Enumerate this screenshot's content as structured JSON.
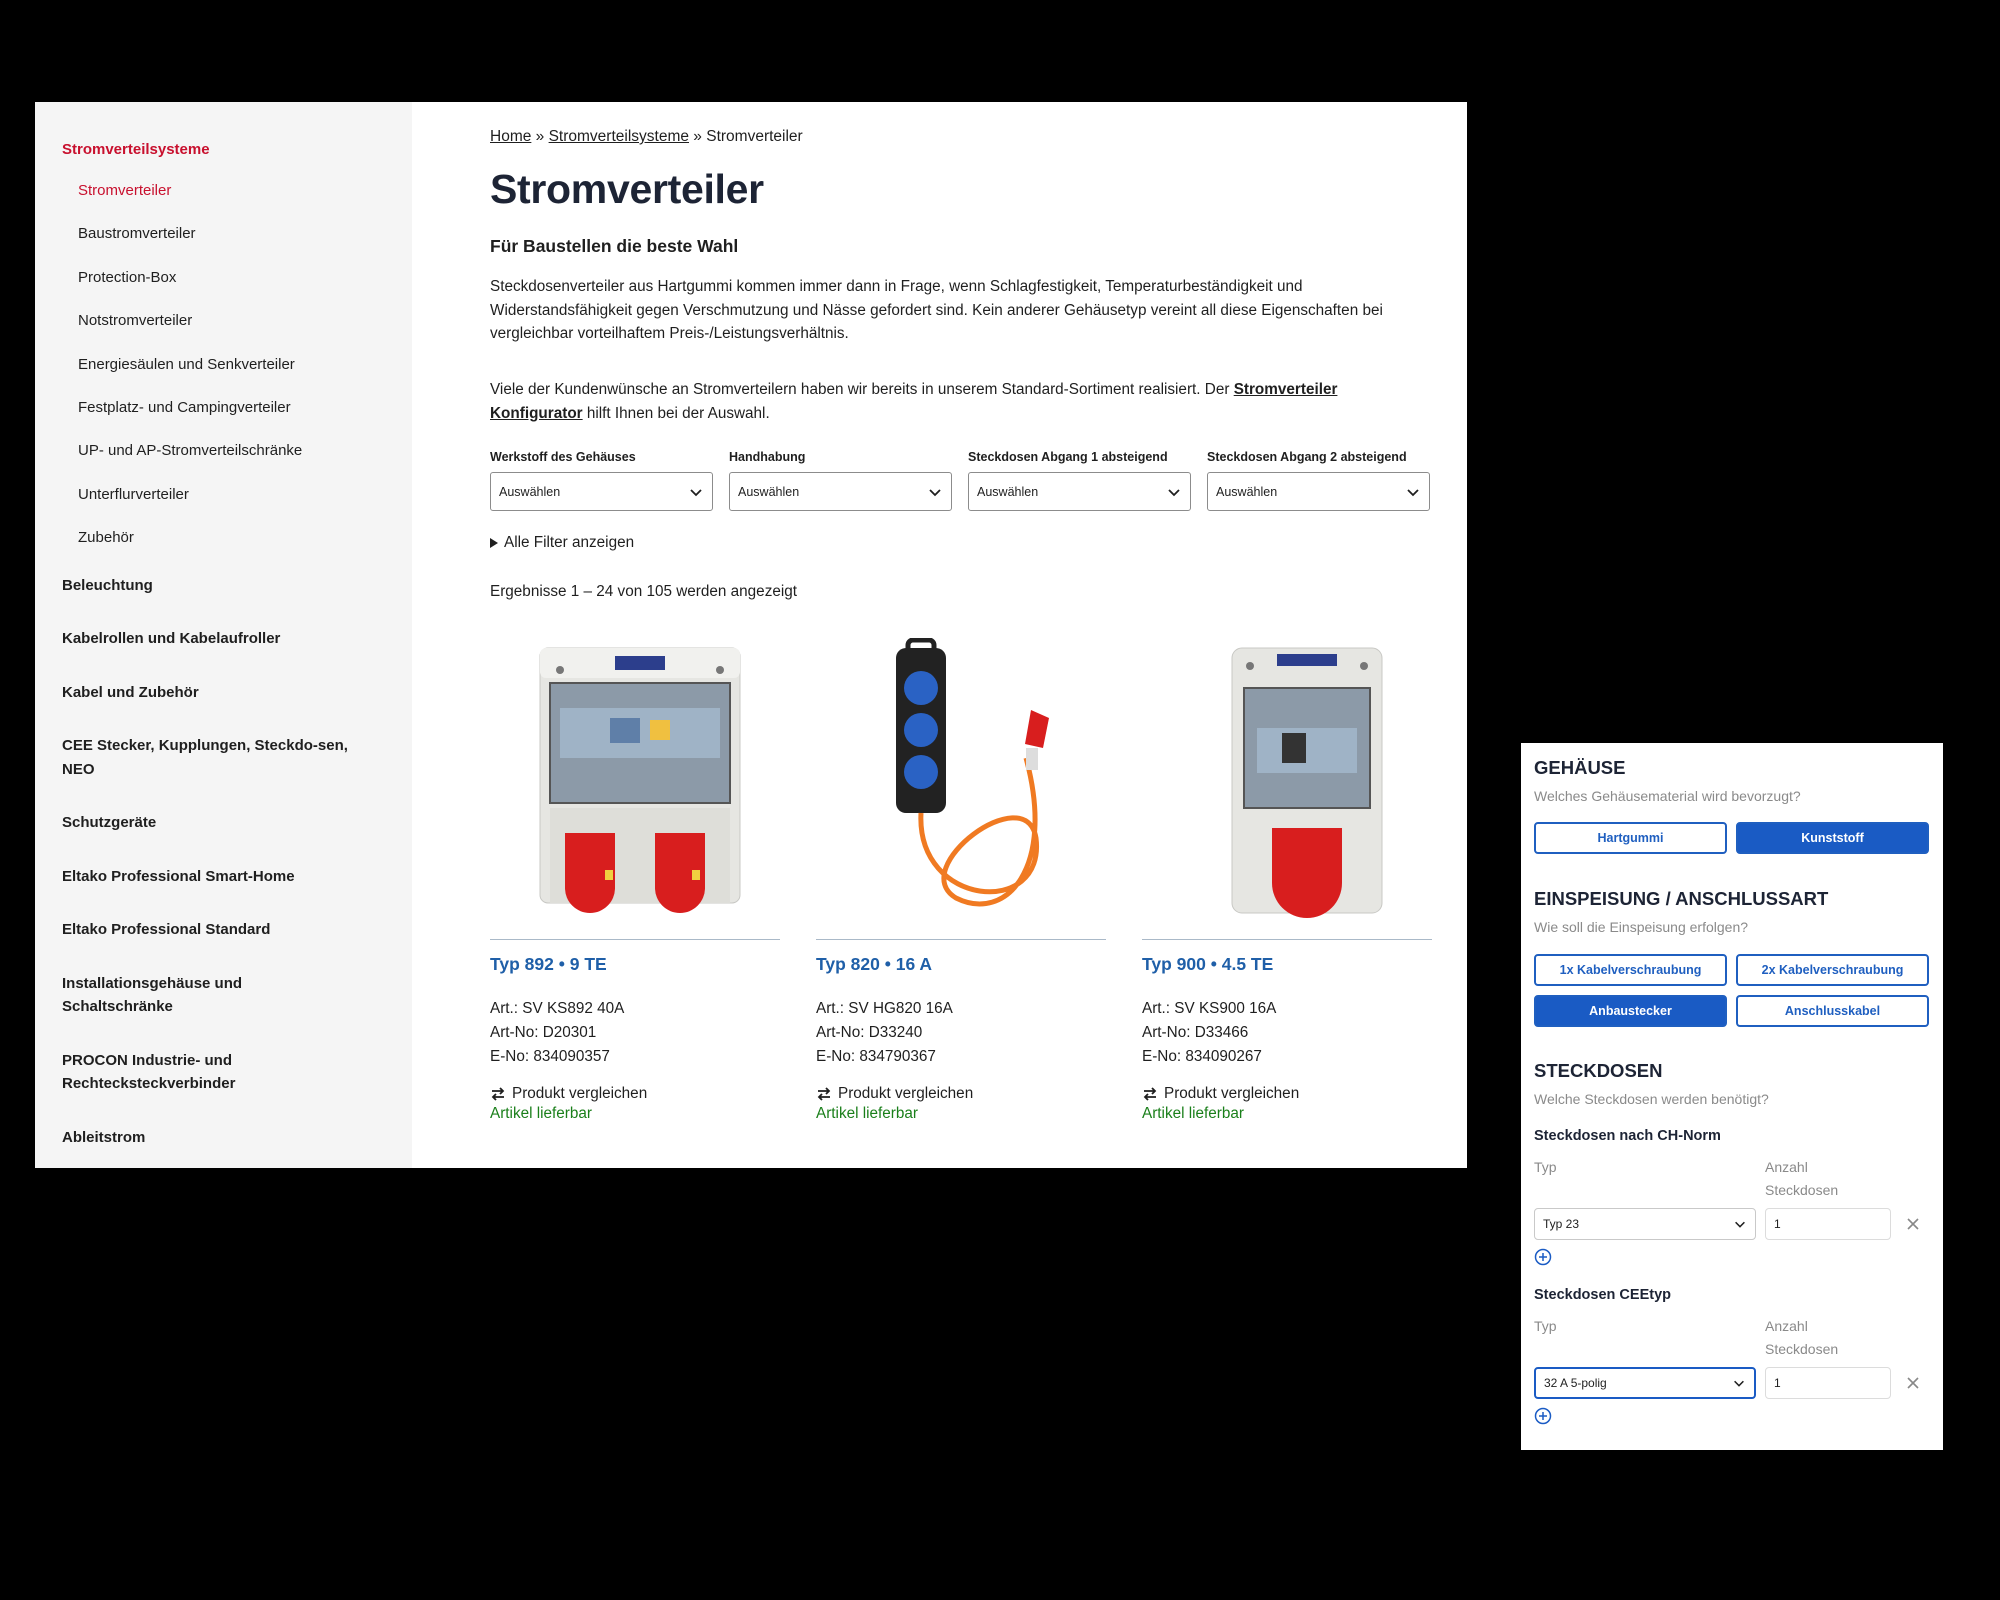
{
  "sidebar": {
    "section_title": "Stromverteilsysteme",
    "sub_items": [
      "Stromverteiler",
      "Baustromverteiler",
      "Protection-Box",
      "Notstromverteiler",
      "Energiesäulen und Senkverteiler",
      "Festplatz- und Campingverteiler",
      "UP- und AP-Stromverteilschränke",
      "Unterflurverteiler",
      "Zubehör"
    ],
    "categories": [
      "Beleuchtung",
      "Kabelrollen und Kabelaufroller",
      "Kabel und Zubehör",
      "CEE Stecker, Kupplungen, Steckdo-sen, NEO",
      "Schutzgeräte",
      "Eltako Professional Smart-Home",
      "Eltako Professional Standard",
      "Installationsgehäuse und Schaltschränke",
      "PROCON Industrie- und Rechtecksteckverbinder",
      "Ableitstrom"
    ]
  },
  "breadcrumb": {
    "home": "Home",
    "sep1": " » ",
    "level1": "Stromverteilsysteme",
    "sep2": " » ",
    "current": "Stromverteiler"
  },
  "page": {
    "title": "Stromverteiler",
    "subtitle": "Für Baustellen die beste Wahl",
    "paragraph1": "Steckdosenverteiler aus Hartgummi kommen immer dann in Frage, wenn Schlagfestigkeit, Temperaturbeständigkeit und Widerstandsfähigkeit gegen Verschmutzung und Nässe gefordert sind. Kein anderer Gehäusetyp vereint all diese Eigenschaften bei vergleichbar vorteilhaftem Preis-/Leistungsverhältnis.",
    "paragraph2_pre": "Viele der Kundenwünsche an Stromverteilern haben wir bereits in unserem Standard-Sortiment realisiert. Der ",
    "paragraph2_link": "Stromverteiler Konfigurator",
    "paragraph2_post": " hilft Ihnen bei der Auswahl."
  },
  "filters": [
    {
      "label": "Werkstoff des Gehäuses",
      "value": "Auswählen"
    },
    {
      "label": "Handhabung",
      "value": "Auswählen"
    },
    {
      "label": "Steckdosen Abgang 1 absteigend",
      "value": "Auswählen"
    },
    {
      "label": "Steckdosen Abgang 2 absteigend",
      "value": "Auswählen"
    }
  ],
  "all_filters_label": "Alle Filter anzeigen",
  "results_text": "Ergebnisse 1 – 24 von 105 werden angezeigt",
  "products": [
    {
      "title": "Typ 892 • 9 TE",
      "art": "Art.: SV KS892 40A",
      "artno": "Art-No: D20301",
      "eno": "E-No: 834090357",
      "compare": "Produkt vergleichen",
      "stock": "Artikel lieferbar"
    },
    {
      "title": "Typ 820 • 16 A",
      "art": "Art.: SV HG820 16A",
      "artno": "Art-No: D33240",
      "eno": "E-No: 834790367",
      "compare": "Produkt vergleichen",
      "stock": "Artikel lieferbar"
    },
    {
      "title": "Typ 900 • 4.5 TE",
      "art": "Art.: SV KS900 16A",
      "artno": "Art-No: D33466",
      "eno": "E-No: 834090267",
      "compare": "Produkt vergleichen",
      "stock": "Artikel lieferbar"
    }
  ],
  "configurator": {
    "housing": {
      "title": "GEHÄUSE",
      "question": "Welches Gehäusematerial wird bevorzugt?",
      "options": [
        "Hartgummi",
        "Kunststoff"
      ],
      "selected": "Kunststoff"
    },
    "feed": {
      "title": "EINSPEISUNG / ANSCHLUSSART",
      "question": "Wie soll die Einspeisung erfolgen?",
      "options": [
        "1x Kabelverschraubung",
        "2x Kabelverschraubung",
        "Anbaustecker",
        "Anschlusskabel"
      ],
      "selected": "Anbaustecker"
    },
    "sockets": {
      "title": "STECKDOSEN",
      "question": "Welche Steckdosen werden benötigt?",
      "groups": [
        {
          "name": "Steckdosen nach CH-Norm",
          "type_label": "Typ",
          "count_label_1": "Anzahl",
          "count_label_2": "Steckdosen",
          "type_value": "Typ 23",
          "count_value": "1"
        },
        {
          "name": "Steckdosen CEEtyp",
          "type_label": "Typ",
          "count_label_1": "Anzahl",
          "count_label_2": "Steckdosen",
          "type_value": "32 A 5-polig",
          "count_value": "1"
        }
      ]
    }
  },
  "colors": {
    "accent_red": "#c8102e",
    "link_blue": "#1f5fa8",
    "button_blue": "#1a5bc4",
    "stock_green": "#1a7f1a"
  }
}
